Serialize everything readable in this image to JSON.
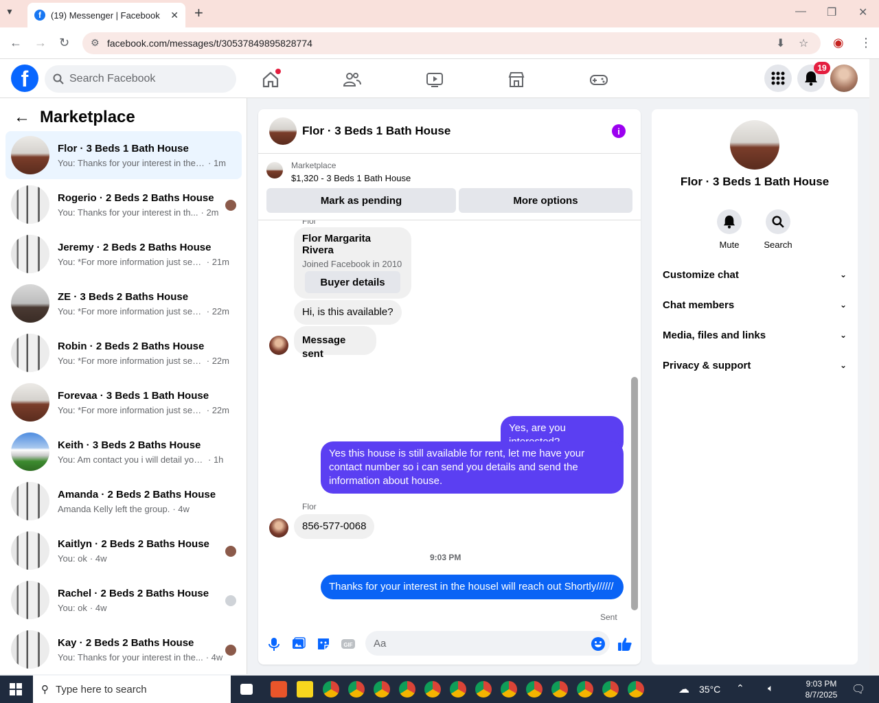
{
  "browser": {
    "tab_title": "(19) Messenger | Facebook",
    "url": "facebook.com/messages/t/30537849895828774"
  },
  "fbnav": {
    "search_placeholder": "Search Facebook",
    "notifications_count": "19"
  },
  "sidebar": {
    "title": "Marketplace",
    "conversations": [
      {
        "name": "Flor · 3 Beds 1 Bath House",
        "preview": "You: Thanks for your interest in the h...",
        "time": "· 1m",
        "thumb": "room"
      },
      {
        "name": "Rogerio · 2 Beds 2 Baths House",
        "preview": "You: Thanks for your interest in th...",
        "time": "· 2m",
        "thumb": "col"
      },
      {
        "name": "Jeremy · 2 Beds 2 Baths House",
        "preview": "You: *For more information just sen...",
        "time": "· 21m",
        "thumb": "col"
      },
      {
        "name": "ZE · 3 Beds 2 Baths House",
        "preview": "You: *For more information just sen...",
        "time": "· 22m",
        "thumb": "room2"
      },
      {
        "name": "Robin · 2 Beds 2 Baths House",
        "preview": "You: *For more information just sen...",
        "time": "· 22m",
        "thumb": "col"
      },
      {
        "name": "Forevaa · 3 Beds 1 Bath House",
        "preview": "You: *For more information just sen...",
        "time": "· 22m",
        "thumb": "room"
      },
      {
        "name": "Keith · 3 Beds 2 Baths House",
        "preview": "You: Am contact you i will detail you. ...",
        "time": "· 1h",
        "thumb": "out"
      },
      {
        "name": "Amanda · 2 Beds 2 Baths House",
        "preview": "Amanda Kelly left the group.",
        "time": "· 4w",
        "thumb": "col"
      },
      {
        "name": "Kaitlyn · 2 Beds 2 Baths House",
        "preview": "You: ok",
        "time": "· 4w",
        "thumb": "col"
      },
      {
        "name": "Rachel · 2 Beds 2 Baths House",
        "preview": "You: ok",
        "time": "· 4w",
        "thumb": "col"
      },
      {
        "name": "Kay · 2 Beds 2 Baths House",
        "preview": "You: Thanks for your interest in the...",
        "time": "· 4w",
        "thumb": "col"
      }
    ]
  },
  "chat": {
    "title": "Flor · 3 Beds 1 Bath House",
    "listing_label": "Marketplace",
    "listing_price": "$1,320 - 3 Beds 1 Bath House",
    "mark_pending": "Mark as pending",
    "more_options": "More options",
    "buyer_name": "Flor Margarita Rivera",
    "buyer_joined": "Joined Facebook in 2010",
    "buyer_details": "Buyer details",
    "top_label": "Flor",
    "msg_1": "Hi, is this available?",
    "msg_2": "Message sent",
    "msg_3": "Yes, are you interested?",
    "msg_4": "Yes this house is still available for rent, let me have your contact number so i can send you details and send the information about house.",
    "sender_label": "Flor",
    "msg_5": "856-577-0068",
    "timestamp": "9:03 PM",
    "msg_6": "Thanks for your interest in the housel will reach out Shortly//////",
    "status": "Sent",
    "composer_placeholder": "Aa"
  },
  "details": {
    "name": "Flor · 3 Beds 1 Bath House",
    "mute": "Mute",
    "search": "Search",
    "sections": [
      "Customize chat",
      "Chat members",
      "Media, files and links",
      "Privacy & support"
    ]
  },
  "taskbar": {
    "search_placeholder": "Type here to search",
    "weather": "35°C",
    "time": "9:03 PM",
    "date": "8/7/2025"
  },
  "colors": {
    "fb_blue": "#0866ff",
    "outgoing_purple": "#5b3ff2",
    "outgoing_blue": "#0a63f5",
    "badge_red": "#e41e3f"
  }
}
